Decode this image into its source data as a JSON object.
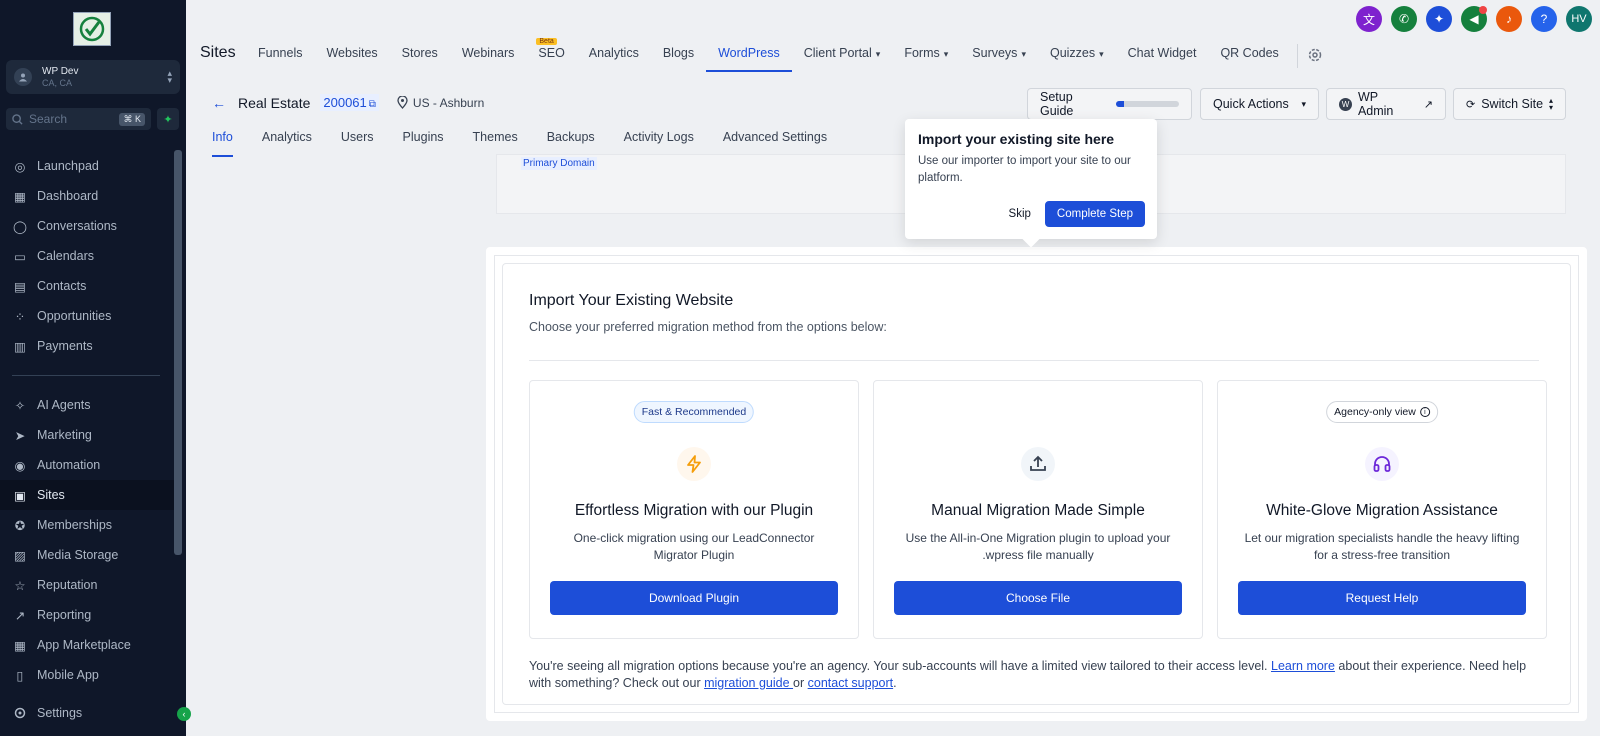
{
  "sidebar": {
    "account_name": "WP Dev",
    "account_location": "CA, CA",
    "search_placeholder": "Search",
    "search_shortcut": "⌘ K",
    "items_top": [
      {
        "label": "Launchpad",
        "icon": "rocket-icon"
      },
      {
        "label": "Dashboard",
        "icon": "grid-icon"
      },
      {
        "label": "Conversations",
        "icon": "chat-icon"
      },
      {
        "label": "Calendars",
        "icon": "calendar-icon"
      },
      {
        "label": "Contacts",
        "icon": "contacts-icon"
      },
      {
        "label": "Opportunities",
        "icon": "funnel-icon"
      },
      {
        "label": "Payments",
        "icon": "receipt-icon"
      }
    ],
    "items_bottom": [
      {
        "label": "AI Agents",
        "icon": "sparkle-icon"
      },
      {
        "label": "Marketing",
        "icon": "send-icon"
      },
      {
        "label": "Automation",
        "icon": "automation-icon"
      },
      {
        "label": "Sites",
        "icon": "sites-icon"
      },
      {
        "label": "Memberships",
        "icon": "award-icon"
      },
      {
        "label": "Media Storage",
        "icon": "image-icon"
      },
      {
        "label": "Reputation",
        "icon": "star-icon"
      },
      {
        "label": "Reporting",
        "icon": "chart-icon"
      },
      {
        "label": "App Marketplace",
        "icon": "apps-icon"
      },
      {
        "label": "Mobile App",
        "icon": "mobile-icon"
      }
    ],
    "settings_label": "Settings",
    "active_item": "Sites"
  },
  "topnav": {
    "title": "Sites",
    "tabs": [
      {
        "label": "Funnels"
      },
      {
        "label": "Websites"
      },
      {
        "label": "Stores"
      },
      {
        "label": "Webinars"
      },
      {
        "label": "SEO",
        "badge": "Beta"
      },
      {
        "label": "Analytics"
      },
      {
        "label": "Blogs"
      },
      {
        "label": "WordPress",
        "active": true
      },
      {
        "label": "Client Portal",
        "dropdown": true
      },
      {
        "label": "Forms",
        "dropdown": true
      },
      {
        "label": "Surveys",
        "dropdown": true
      },
      {
        "label": "Quizzes",
        "dropdown": true
      },
      {
        "label": "Chat Widget"
      },
      {
        "label": "QR Codes"
      }
    ],
    "avatar_initials": "HV"
  },
  "site": {
    "name": "Real Estate",
    "id": "200061",
    "location": "US - Ashburn",
    "subtabs": [
      "Info",
      "Analytics",
      "Users",
      "Plugins",
      "Themes",
      "Backups",
      "Activity Logs",
      "Advanced Settings"
    ],
    "active_subtab": "Info",
    "primary_domain_label": "Primary Domain"
  },
  "header_buttons": {
    "setup_guide": "Setup Guide",
    "setup_progress": 0.12,
    "quick_actions": "Quick Actions",
    "wp_admin": "WP Admin",
    "switch_site": "Switch Site"
  },
  "popover": {
    "title": "Import your existing site here",
    "text": "Use our importer to import your site to our platform.",
    "skip": "Skip",
    "complete": "Complete Step"
  },
  "modal": {
    "title": "Import Your Existing Website",
    "subtitle": "Choose your preferred migration method from the options below:",
    "cards": [
      {
        "badge": "Fast & Recommended",
        "icon": "lightning-icon",
        "title": "Effortless Migration with our Plugin",
        "desc": "One-click migration using our LeadConnector Migrator Plugin",
        "button": "Download Plugin"
      },
      {
        "badge": "",
        "icon": "upload-icon",
        "title": "Manual Migration Made Simple",
        "desc": "Use the All-in-One Migration plugin to upload your .wpress file manually",
        "button": "Choose File"
      },
      {
        "badge": "Agency-only view",
        "icon": "headphones-icon",
        "title": "White-Glove Migration Assistance",
        "desc": "Let our migration specialists handle the heavy lifting for a stress-free transition",
        "button": "Request Help"
      }
    ],
    "footer": {
      "part1": "You're seeing all migration options because you're an agency. Your sub-accounts will have a limited view tailored to their access level. ",
      "link1": "Learn more",
      "part2": " about their experience. Need help with something? Check out our ",
      "link2": "migration guide ",
      "part3": "or ",
      "link3": "contact support",
      "part4": "."
    }
  },
  "colors": {
    "sidebar_bg": "#0f1729",
    "accent": "#1d4ed8",
    "top_icons": [
      "#7e22ce",
      "#15803d",
      "#1d4ed8",
      "#15803d",
      "#ea580c",
      "#2563eb",
      "#0f766e"
    ]
  }
}
